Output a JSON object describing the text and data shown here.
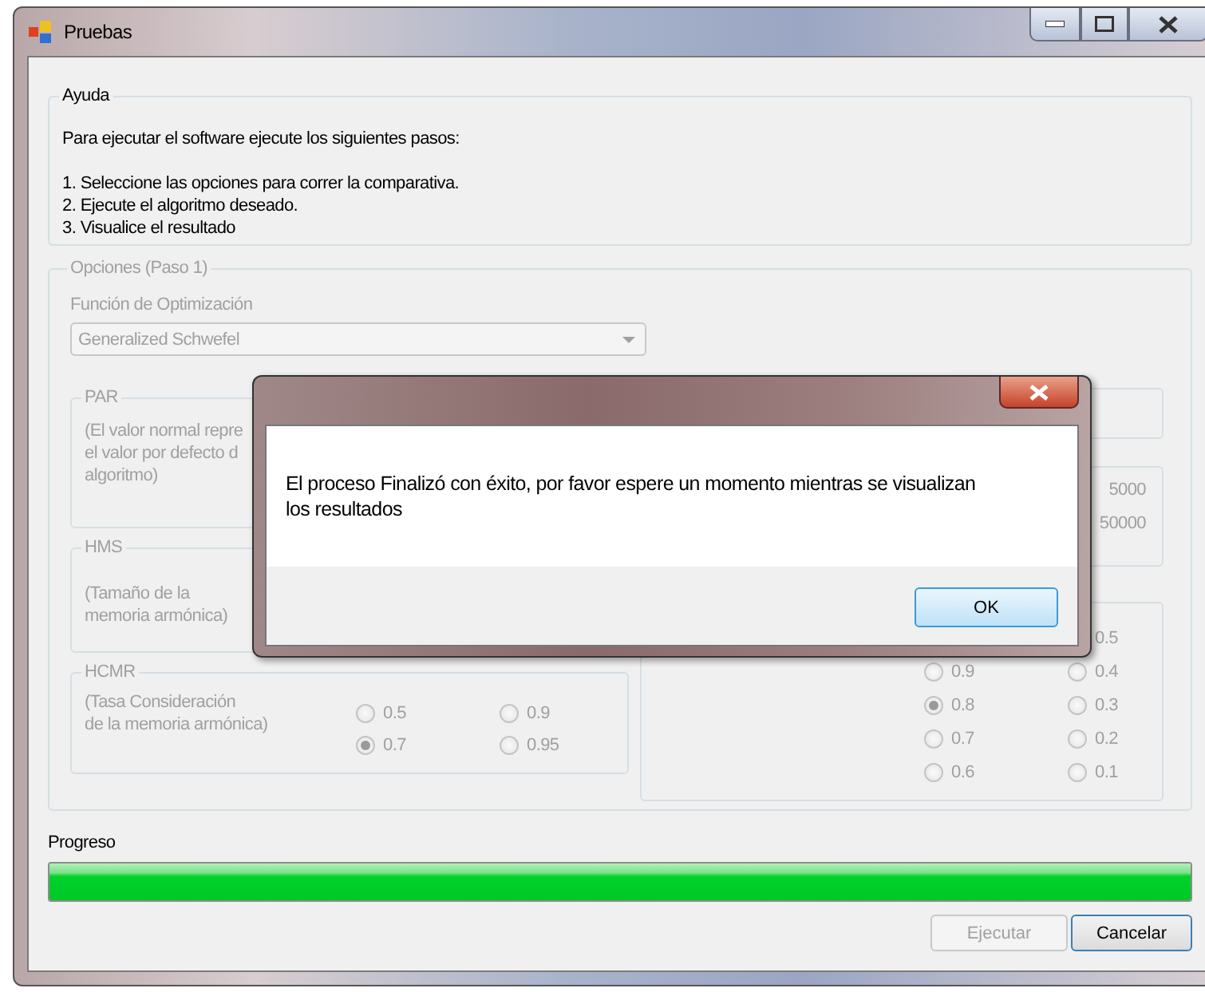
{
  "window": {
    "title": "Pruebas"
  },
  "help": {
    "title": "Ayuda",
    "intro": "Para ejecutar el software ejecute los siguientes pasos:",
    "steps": [
      "1. Seleccione las opciones para correr la comparativa.",
      "2. Ejecute el algoritmo deseado.",
      "3. Visualice el resultado"
    ]
  },
  "options": {
    "title": "Opciones (Paso 1)",
    "disabled": true,
    "function_label": "Función de Optimización",
    "function_value": "Generalized Schwefel",
    "par": {
      "title": "PAR",
      "description": [
        "(El valor normal repre",
        "el valor por defecto d",
        "algoritmo)"
      ]
    },
    "hms": {
      "title": "HMS",
      "description": [
        "(Tamaño de la",
        "memoria armónica)"
      ]
    },
    "hcmr": {
      "title": "HCMR",
      "description": [
        "(Tasa Consideración",
        "de la memoria armónica)"
      ],
      "radios": [
        {
          "label": "0.5",
          "selected": false
        },
        {
          "label": "0.9",
          "selected": false
        },
        {
          "label": "0.7",
          "selected": true
        },
        {
          "label": "0.95",
          "selected": false
        }
      ]
    },
    "right_partial_labels": [
      "5000",
      "50000"
    ],
    "right_radios_left": [
      {
        "label": "0.9",
        "selected": false
      },
      {
        "label": "0.8",
        "selected": true
      },
      {
        "label": "0.7",
        "selected": false
      },
      {
        "label": "0.6",
        "selected": false
      }
    ],
    "right_radios_right": [
      {
        "label": "0.5"
      },
      {
        "label": "0.4",
        "selected": false
      },
      {
        "label": "0.3",
        "selected": false
      },
      {
        "label": "0.2",
        "selected": false
      },
      {
        "label": "0.1",
        "selected": false
      }
    ]
  },
  "progress": {
    "label": "Progreso",
    "level": 1.0
  },
  "buttons": [
    {
      "label": "Ejecutar",
      "disabled": true
    },
    {
      "label": "Cancelar",
      "disabled": false
    }
  ],
  "dialog": {
    "message": "El proceso Finalizó con éxito, por favor espere un momento mientras se visualizan los resultados",
    "button": "OK"
  }
}
